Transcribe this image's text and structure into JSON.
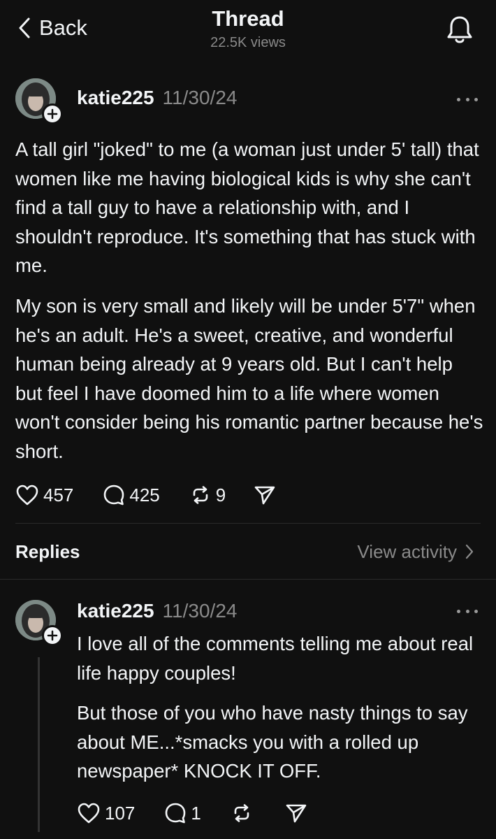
{
  "header": {
    "back_label": "Back",
    "title": "Thread",
    "views": "22.5K views"
  },
  "post": {
    "username": "katie225",
    "timestamp": "11/30/24",
    "paragraphs": [
      "A tall girl \"joked\" to me (a woman just under 5' tall) that women like me having biological kids is why she can't find a tall guy to have a relationship with, and I shouldn't reproduce. It's something that has stuck with me.",
      "My son is very small and likely will be under 5'7\" when he's an adult. He's a sweet, creative, and wonderful human being already at 9 years old. But I can't help but feel I have doomed him to a life where women won't consider being his romantic partner because he's short."
    ],
    "likes": "457",
    "comments": "425",
    "reposts": "9"
  },
  "replies_bar": {
    "label": "Replies",
    "view_activity": "View activity"
  },
  "reply": {
    "username": "katie225",
    "timestamp": "11/30/24",
    "paragraphs": [
      "I love all of the comments telling me about real life happy couples!",
      "But those of you who have nasty things to say about ME...*smacks you with a rolled up newspaper* KNOCK IT OFF."
    ],
    "likes": "107",
    "comments": "1",
    "reposts": ""
  },
  "icons": {
    "back": "chevron-left-icon",
    "bell": "bell-icon",
    "more": "more-dots-icon",
    "like": "heart-icon",
    "comment": "comment-bubble-icon",
    "repost": "repost-icon",
    "share": "send-icon",
    "follow": "plus-icon",
    "view_activity": "chevron-right-icon"
  },
  "colors": {
    "background": "#101010",
    "text": "#f3f5f7",
    "muted": "#8a8a8a"
  }
}
